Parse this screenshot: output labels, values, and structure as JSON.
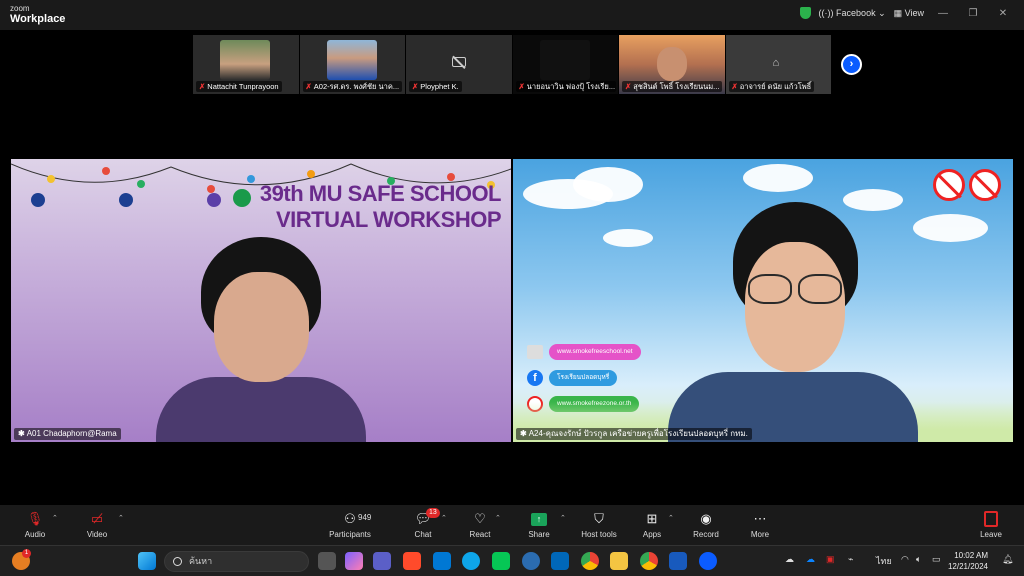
{
  "app": {
    "brand_small": "zoom",
    "brand_big": "Workplace"
  },
  "titlebar": {
    "facebook_label": "Facebook",
    "view_label": "View"
  },
  "participants_strip": [
    {
      "name": "Nattachit Tunprayoon",
      "muted": true,
      "video": true
    },
    {
      "name": "A02-รศ.ดร. พงศ์ชัย นาค...",
      "muted": true,
      "video": true
    },
    {
      "name": "Ployphet K.",
      "muted": true,
      "video": false
    },
    {
      "name": "นายอนาวิน ฟองปุ้ โรงเรีย...",
      "muted": true,
      "video": true
    },
    {
      "name": "สุชสินต์ โพธิ์ โรงเรียนนม...",
      "muted": true,
      "video": true
    },
    {
      "name": "อาจารย์ ดนัย แก้วโพธิ์",
      "muted": true,
      "video": false
    }
  ],
  "main_left": {
    "banner_title_line1": "39th MU SAFE SCHOOL",
    "banner_title_line2": "VIRTUAL WORKSHOP",
    "participant_name": "A01 Chadaphorn@Rama"
  },
  "main_right": {
    "participant_name": "A24-คุณจงรักษ์ ปัวรกูล เครือข่ายครูเพื่อโรงเรียนปลอดบุหรี่ กทม.",
    "site_1": "www.smokefreeschool.net",
    "site_2": "โรงเรียนปลอดบุหรี่",
    "site_3": "www.smokefreezone.or.th"
  },
  "toolbar": {
    "audio": "Audio",
    "video": "Video",
    "participants": "Participants",
    "participants_count": "949",
    "chat": "Chat",
    "chat_badge": "13",
    "react": "React",
    "share": "Share",
    "host_tools": "Host tools",
    "apps": "Apps",
    "record": "Record",
    "more": "More",
    "leave": "Leave"
  },
  "taskbar": {
    "search_placeholder": "ค้นหา",
    "notif_badge": "1",
    "lang": "ไทย",
    "time": "10:02 AM",
    "date": "12/21/2024"
  },
  "colors": {
    "zoom_blue": "#0b5cff",
    "leave_red": "#e02828",
    "share_green": "#1aa35a",
    "banner_purple": "#6a2b8c"
  }
}
